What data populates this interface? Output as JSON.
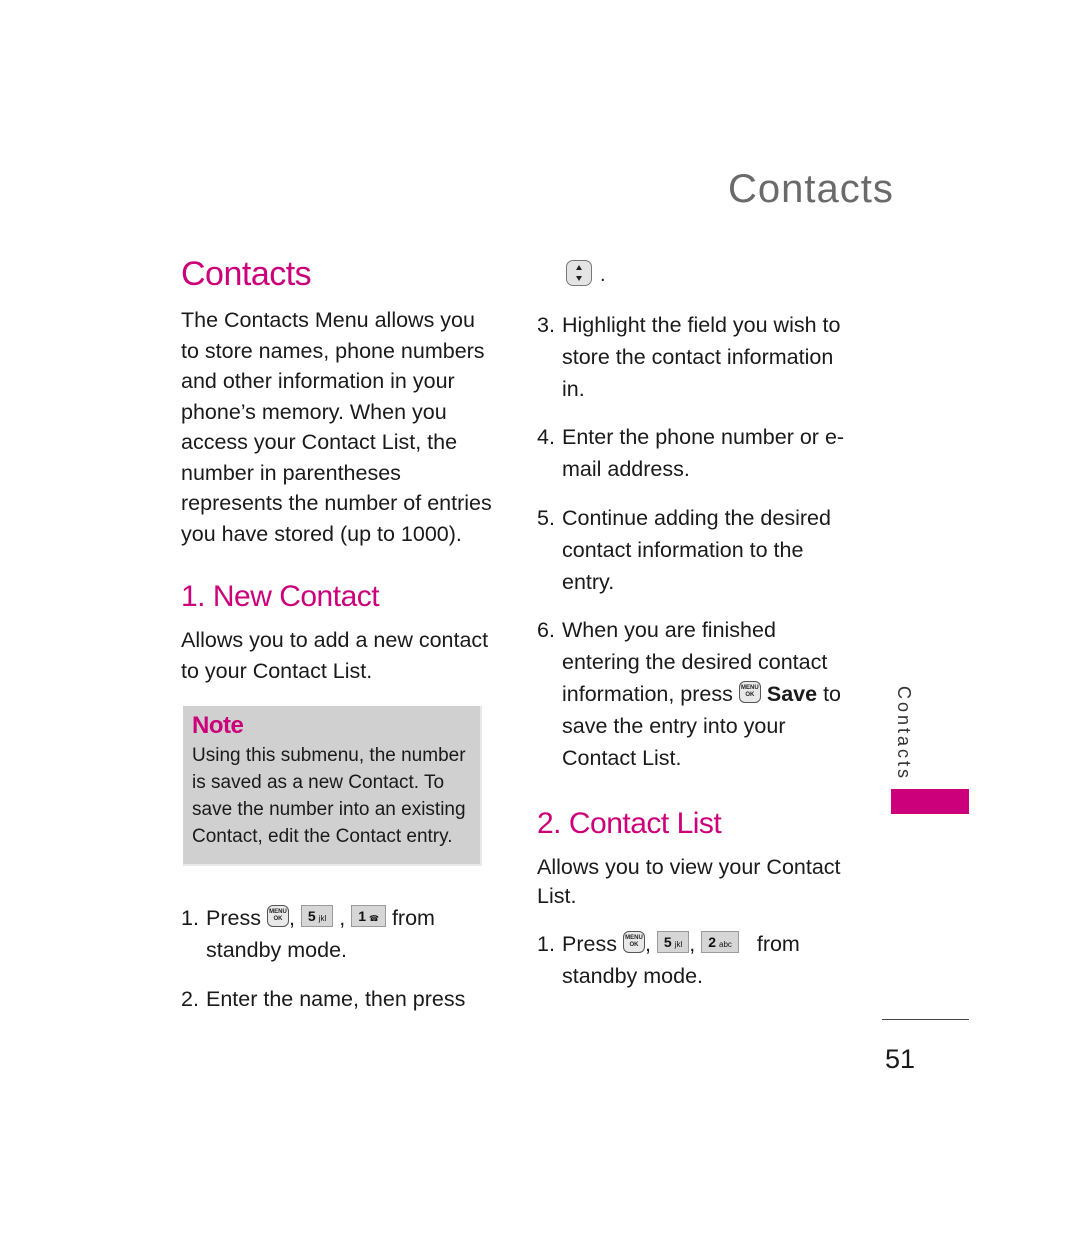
{
  "running_header": "Contacts",
  "main_title": "Contacts",
  "intro": "The Contacts Menu allows you to store names, phone numbers and other information in your phone’s memory. When you access your Contact List, the number in parentheses represents the number of entries you have stored (up to 1000).",
  "sections": {
    "new_contact": {
      "title": "1. New Contact",
      "description": "Allows you to add a new contact to your Contact List.",
      "note": {
        "title": "Note",
        "text": "Using this submenu, the number is saved as a new Contact. To save the number into an existing Contact, edit the Contact entry."
      },
      "steps": [
        {
          "num": "1.",
          "prefix": "Press",
          "keys": [
            "MENU/OK",
            "5 jkl",
            "1"
          ],
          "suffix": "from standby mode."
        },
        {
          "num": "2.",
          "text": "Enter the name, then press",
          "continuation_key": "navigation-up-down",
          "continuation_suffix": "."
        },
        {
          "num": "3.",
          "text": "Highlight the field you wish to store the contact information in."
        },
        {
          "num": "4.",
          "text": "Enter the phone number or e-mail address."
        },
        {
          "num": "5.",
          "text": "Continue adding the desired contact information to the entry."
        },
        {
          "num": "6.",
          "text_before": "When you are finished entering the desired contact information, press",
          "key": "MENU/OK",
          "bold": "Save",
          "text_after": "to save the entry into your Contact List."
        }
      ]
    },
    "contact_list": {
      "title": "2. Contact List",
      "description": "Allows you to view your Contact List.",
      "steps": [
        {
          "num": "1.",
          "prefix": "Press",
          "keys": [
            "MENU/OK",
            "5 jkl",
            "2 abc"
          ],
          "suffix": "from standby mode."
        }
      ]
    }
  },
  "keys": {
    "menu_top": "MENU",
    "menu_bottom": "OK",
    "five": "5",
    "five_letters": "jkl",
    "one": "1",
    "one_glyph": "☎",
    "two": "2",
    "two_letters": "abc"
  },
  "side_tab": "Contacts",
  "page_number": "51",
  "colors": {
    "accent": "#cc007a",
    "note_bg": "#d0d0d0",
    "header_gray": "#6a6a6a"
  }
}
